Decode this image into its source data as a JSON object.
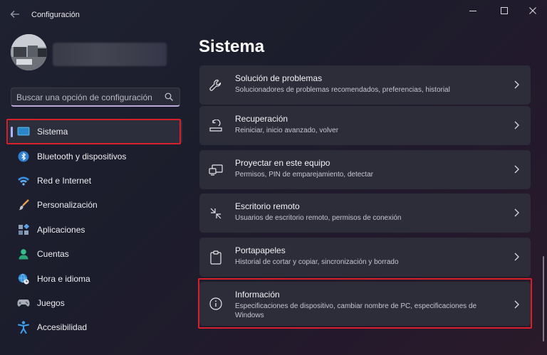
{
  "window": {
    "title": "Configuración"
  },
  "search": {
    "placeholder": "Buscar una opción de configuración"
  },
  "sidebar": {
    "items": [
      {
        "label": "Sistema",
        "icon": "system-display-icon",
        "active": true
      },
      {
        "label": "Bluetooth y dispositivos",
        "icon": "bluetooth-icon"
      },
      {
        "label": "Red e Internet",
        "icon": "wifi-icon"
      },
      {
        "label": "Personalización",
        "icon": "paint-brush-icon"
      },
      {
        "label": "Aplicaciones",
        "icon": "apps-icon"
      },
      {
        "label": "Cuentas",
        "icon": "person-icon"
      },
      {
        "label": "Hora e idioma",
        "icon": "globe-clock-icon"
      },
      {
        "label": "Juegos",
        "icon": "gamepad-icon"
      },
      {
        "label": "Accesibilidad",
        "icon": "accessibility-icon"
      }
    ]
  },
  "main": {
    "title": "Sistema",
    "cards": [
      {
        "title": "Solución de problemas",
        "desc": "Solucionadores de problemas recomendados, preferencias, historial",
        "icon": "wrench-icon"
      },
      {
        "title": "Recuperación",
        "desc": "Reiniciar, inicio avanzado, volver",
        "icon": "recovery-icon"
      },
      {
        "title": "Proyectar en este equipo",
        "desc": "Permisos, PIN de emparejamiento, detectar",
        "icon": "project-icon"
      },
      {
        "title": "Escritorio remoto",
        "desc": "Usuarios de escritorio remoto, permisos de conexión",
        "icon": "remote-desktop-icon"
      },
      {
        "title": "Portapapeles",
        "desc": "Historial de cortar y copiar, sincronización y borrado",
        "icon": "clipboard-icon"
      },
      {
        "title": "Información",
        "desc": "Especificaciones de dispositivo, cambiar nombre de PC, especificaciones de Windows",
        "icon": "info-icon"
      }
    ]
  },
  "colors": {
    "accent": "#a9b7ff",
    "highlight_box": "#d8202a",
    "card_bg": "#2c2d39"
  }
}
